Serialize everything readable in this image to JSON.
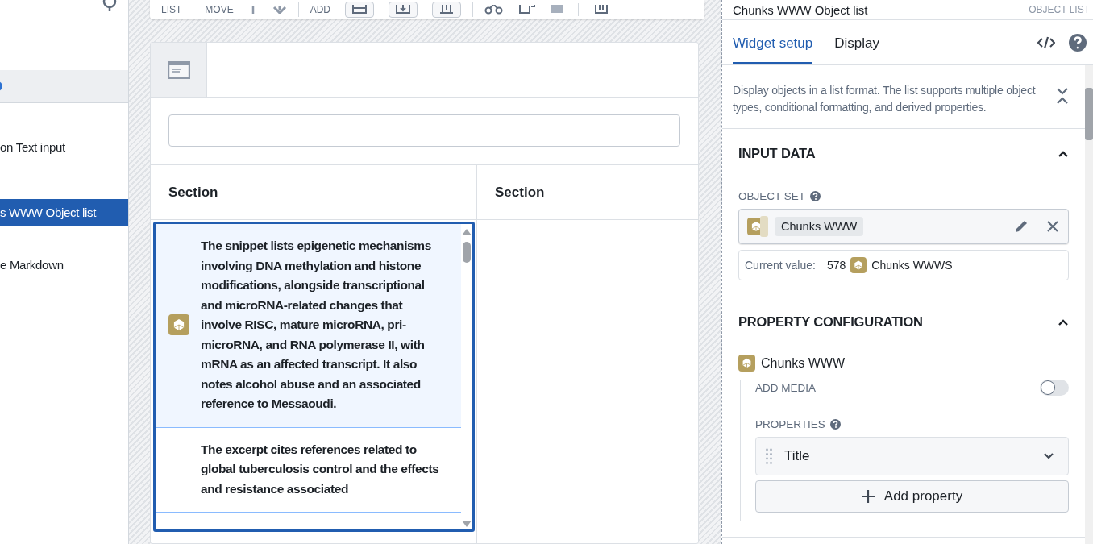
{
  "sidebar": {
    "items": [
      {
        "label": "on Text input",
        "selected": false
      },
      {
        "label": "s WWW Object list",
        "selected": true
      },
      {
        "label": "e Markdown",
        "selected": false
      }
    ]
  },
  "toolbar": {
    "groups": [
      "LIST",
      "MOVE",
      "ADD"
    ]
  },
  "widget": {
    "columns": [
      "Section",
      "Section"
    ],
    "items": [
      {
        "text": "The snippet lists epigenetic mechanisms involving DNA methylation and histone modifications, alongside transcriptional and microRNA-related changes that involve RISC, mature microRNA, pri-microRNA, and RNA polymerase II, with mRNA as an affected transcript. It also notes alcohol abuse and an associated reference to Messaoudi.",
        "selected": true
      },
      {
        "text": "The excerpt cites references related to global tuberculosis control and the effects and resistance associated",
        "selected": false
      }
    ]
  },
  "panel": {
    "title": "Chunks WWW Object list",
    "type_label": "OBJECT LIST",
    "tabs": [
      {
        "label": "Widget setup",
        "selected": true
      },
      {
        "label": "Display",
        "selected": false
      }
    ],
    "description": "Display objects in a list format. The list supports multiple object types, conditional formatting, and derived properties.",
    "input_data": {
      "title": "INPUT DATA",
      "expanded": true,
      "object_set_label": "OBJECT SET",
      "object_set": "Chunks WWW",
      "current_label": "Current value:",
      "current_count": "578",
      "current_name": "Chunks WWWS"
    },
    "property_configuration": {
      "title": "PROPERTY CONFIGURATION",
      "expanded": true,
      "object_type": "Chunks WWW",
      "add_media": {
        "label": "ADD MEDIA",
        "on": false
      },
      "properties_label": "PROPERTIES",
      "properties": [
        {
          "label": "Title"
        }
      ],
      "add_button": "Add property"
    }
  }
}
